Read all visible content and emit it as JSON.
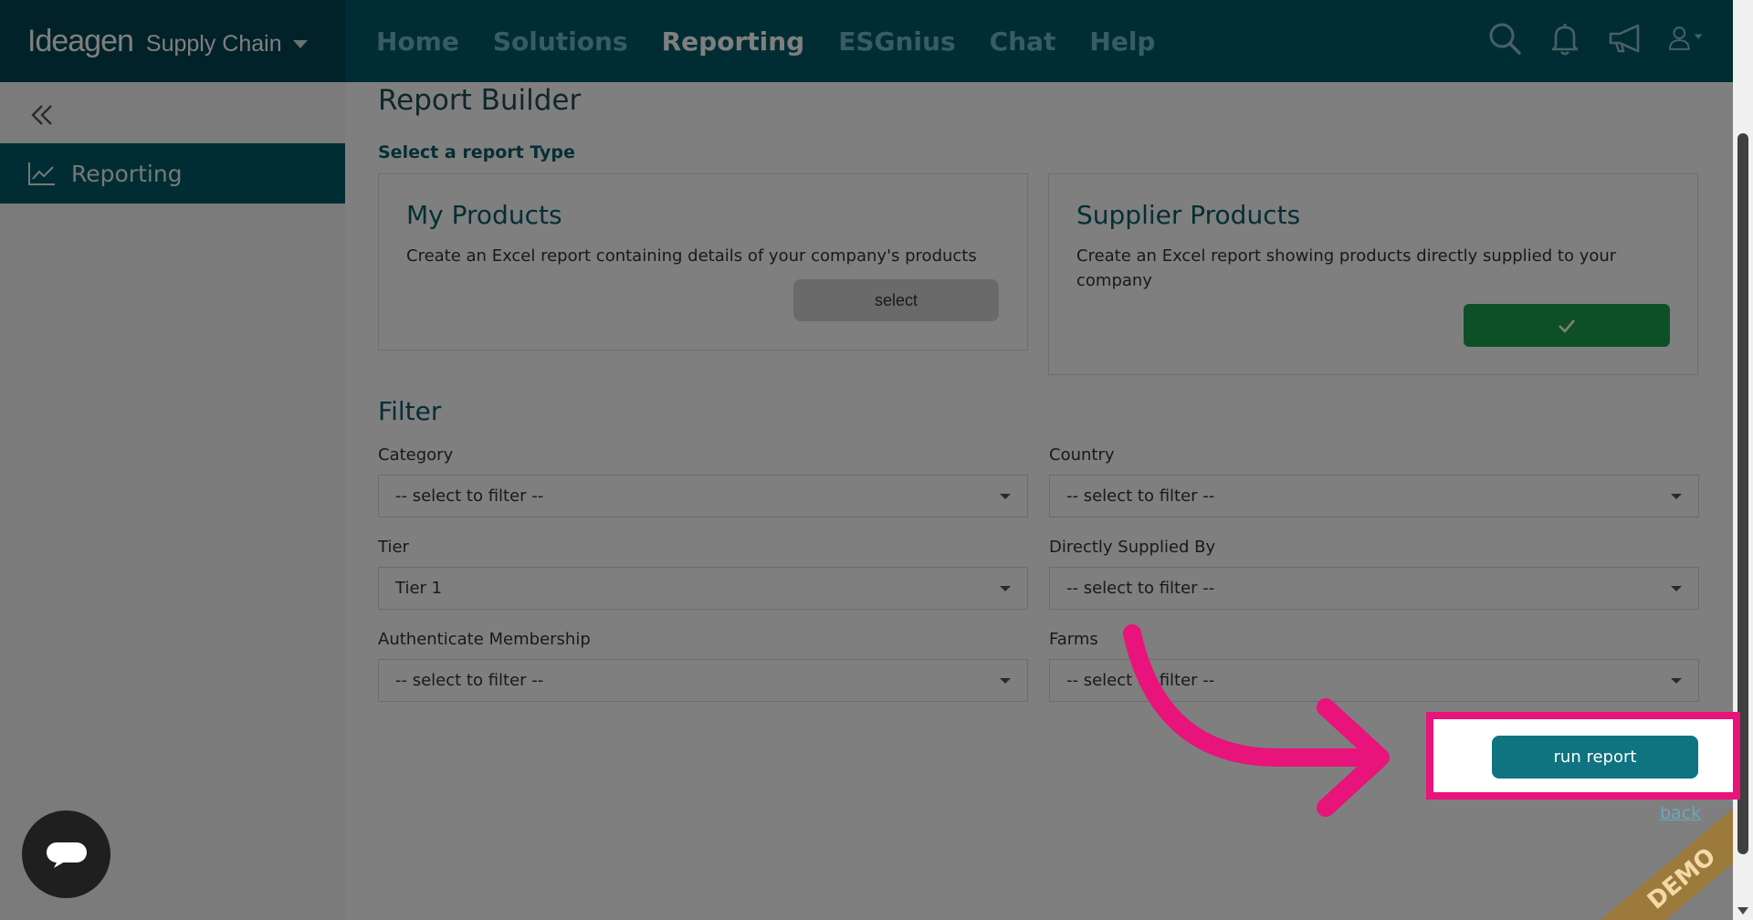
{
  "brand": {
    "logo_text": "Ideagen",
    "product_name": "Supply Chain"
  },
  "nav": {
    "items": [
      "Home",
      "Solutions",
      "Reporting",
      "ESGnius",
      "Chat",
      "Help"
    ],
    "active": "Reporting"
  },
  "header_icons": [
    "search-icon",
    "bell-icon",
    "megaphone-icon",
    "user-icon"
  ],
  "sidebar": {
    "items": [
      {
        "label": "Reporting",
        "icon": "chart-line-icon"
      }
    ]
  },
  "page": {
    "title": "Report Builder",
    "report_type_label": "Select a report Type"
  },
  "report_types": [
    {
      "title": "My Products",
      "description": "Create an Excel report containing details of your company's products",
      "button_label": "select",
      "selected": false
    },
    {
      "title": "Supplier Products",
      "description": "Create an Excel report showing products directly supplied to your company",
      "button_label": "",
      "selected": true
    }
  ],
  "filter": {
    "title": "Filter",
    "fields": [
      {
        "label": "Category",
        "value": "-- select to filter --"
      },
      {
        "label": "Country",
        "value": "-- select to filter --"
      },
      {
        "label": "Tier",
        "value": "Tier 1"
      },
      {
        "label": "Directly Supplied By",
        "value": "-- select to filter --"
      },
      {
        "label": "Authenticate Membership",
        "value": "-- select to filter --"
      },
      {
        "label": "Farms",
        "value": "-- select to filter --"
      }
    ]
  },
  "actions": {
    "run_report": "run report",
    "back": "back"
  },
  "watermark": "DEMO",
  "colors": {
    "header": "#005a67",
    "brand_bg": "#004450",
    "accent": "#0f7380",
    "success": "#1aa14f",
    "callout": "#e8137b"
  }
}
